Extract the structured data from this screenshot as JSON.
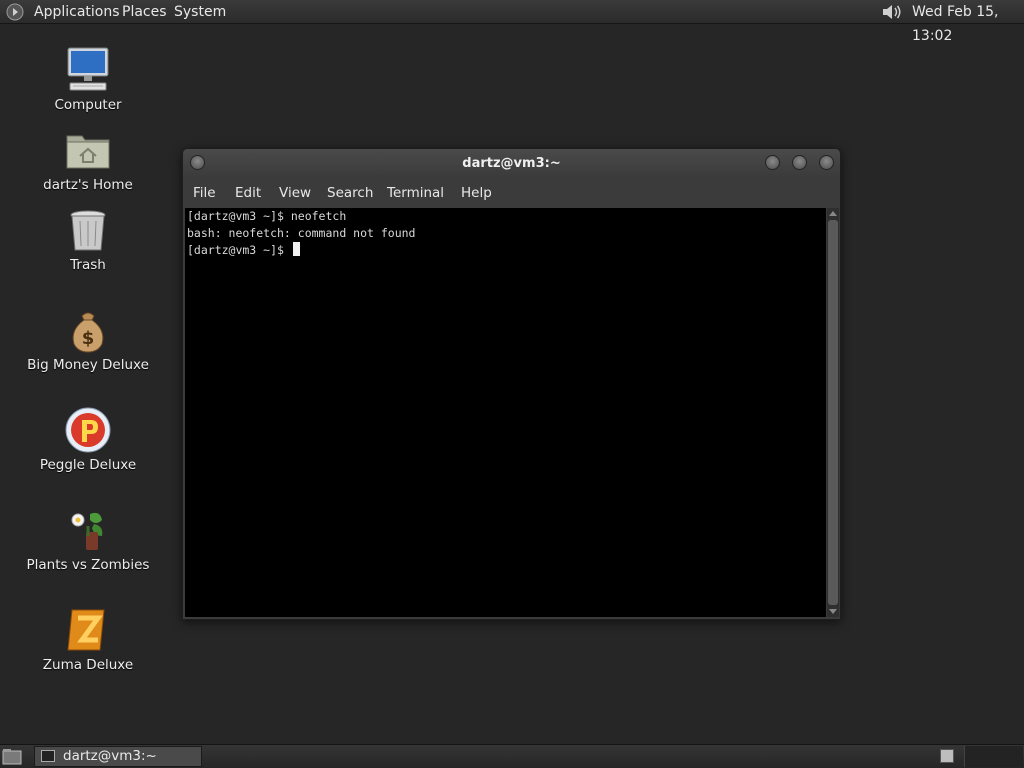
{
  "top_panel": {
    "menus": [
      "Applications",
      "Places",
      "System"
    ],
    "clock": "Wed Feb 15, 13:02",
    "icons": {
      "logo": "gnome-foot-icon",
      "volume": "speaker-icon"
    }
  },
  "desktop_icons": [
    {
      "label": "Computer",
      "icon": "computer-icon"
    },
    {
      "label": "dartz's Home",
      "icon": "home-folder-icon"
    },
    {
      "label": "Trash",
      "icon": "trash-icon"
    },
    {
      "label": "Big Money Deluxe",
      "icon": "money-bag-icon"
    },
    {
      "label": "Peggle Deluxe",
      "icon": "peggle-icon"
    },
    {
      "label": "Plants vs Zombies",
      "icon": "plants-vs-zombies-icon"
    },
    {
      "label": "Zuma Deluxe",
      "icon": "zuma-icon"
    }
  ],
  "terminal": {
    "title": "dartz@vm3:~",
    "menus": [
      "File",
      "Edit",
      "View",
      "Search",
      "Terminal",
      "Help"
    ],
    "lines": [
      "[dartz@vm3 ~]$ neofetch",
      "bash: neofetch: command not found",
      "[dartz@vm3 ~]$ "
    ]
  },
  "bottom_panel": {
    "task_label": "dartz@vm3:~"
  },
  "colors": {
    "desktop_bg": "#262626",
    "panel_bg": "#2f2f2f",
    "terminal_bg": "#000000",
    "terminal_fg": "#d9d9d9"
  }
}
